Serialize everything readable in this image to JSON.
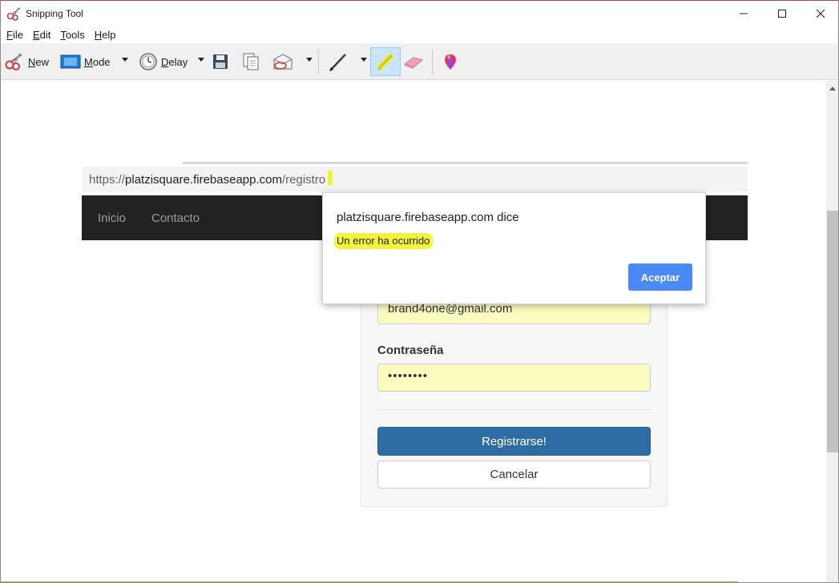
{
  "window": {
    "title": "Snipping Tool"
  },
  "menu": {
    "file": {
      "u": "F",
      "rest": "ile"
    },
    "edit": {
      "u": "E",
      "rest": "dit"
    },
    "tools": {
      "u": "T",
      "rest": "ools"
    },
    "help": {
      "u": "H",
      "rest": "elp"
    }
  },
  "toolbar": {
    "new": {
      "u": "N",
      "rest": "ew"
    },
    "mode": {
      "u": "M",
      "rest": "ode"
    },
    "delay": {
      "u": "D",
      "rest": "elay"
    }
  },
  "browser": {
    "url_prefix": "https://",
    "url_host": "platzisquare.firebaseapp.com",
    "url_path": "/registro"
  },
  "navbar": {
    "items": [
      "Inicio",
      "Contacto"
    ]
  },
  "form": {
    "email_value": "brand4one@gmail.com",
    "password_label": "Contraseña",
    "password_value": "••••••••",
    "submit_label": "Registrarse!",
    "cancel_label": "Cancelar"
  },
  "dialog": {
    "title": "platzisquare.firebaseapp.com dice",
    "message": "Un error ha ocurrido",
    "ok_label": "Aceptar"
  },
  "colors": {
    "highlight": "#f5f23a",
    "navbar": "#222222",
    "primary_button": "#2e6da4",
    "dialog_button": "#4a8af4",
    "autofill": "#fafcbf"
  }
}
